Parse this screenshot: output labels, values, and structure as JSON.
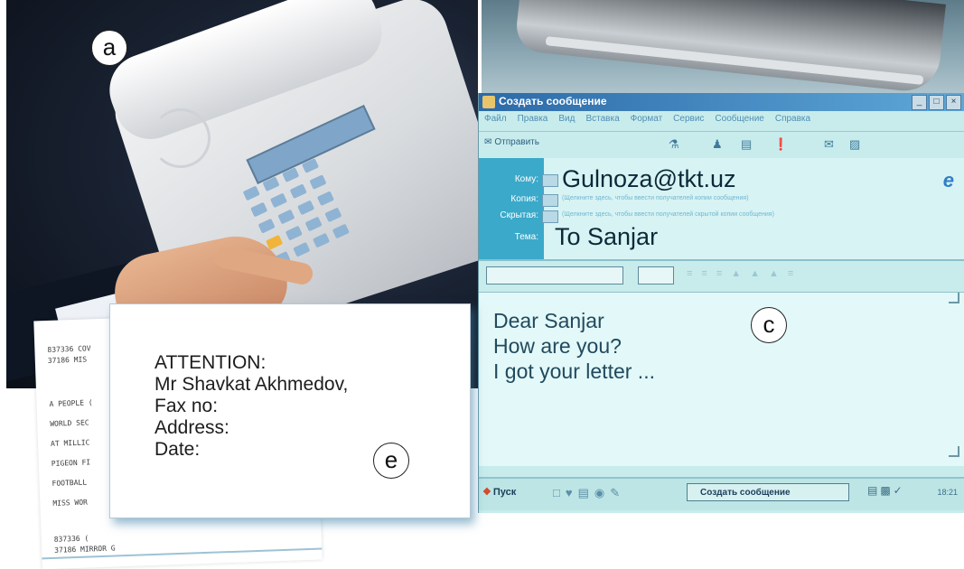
{
  "labels": {
    "a": "a",
    "c": "c",
    "e": "e"
  },
  "email_window": {
    "title": "Создать сообщение",
    "window_buttons": [
      "_",
      "□",
      "×"
    ],
    "menu": [
      "Файл",
      "Правка",
      "Вид",
      "Вставка",
      "Формат",
      "Сервис",
      "Сообщение",
      "Справка"
    ],
    "send_label": "Отправить",
    "headers": [
      {
        "label": "Кому:",
        "value": "Gulnoza@tkt.uz"
      },
      {
        "label": "Копия:",
        "value": "(Щелкните здесь, чтобы ввести получателей копии сообщения)"
      },
      {
        "label": "Скрытая:",
        "value": "(Щелкните здесь, чтобы ввести получателей скрытой копии сообщения)"
      },
      {
        "label": "Тема:",
        "value": "To Sanjar"
      }
    ],
    "body_lines": [
      "Dear Sanjar",
      "How are you?",
      "I got your letter ..."
    ],
    "taskbar": {
      "start_label": "Пуск",
      "task_label": "Создать сообщение",
      "clock": "18:21"
    }
  },
  "fax_printout": {
    "lines": [
      "837336 COV",
      "37186 MIS",
      "A PEOPLE (",
      "WORLD SEC",
      "AT MILLIC",
      "PIGEON FI",
      "FOOTBALL",
      "MISS WOR",
      "837336 (",
      "37186 MIRROR G"
    ]
  },
  "fax_cover": {
    "lines": [
      "ATTENTION:",
      "Mr Shavkat Akhmedov,",
      "Fax no:",
      "Address:",
      "Date:"
    ]
  },
  "colors": {
    "accent": "#3ba9c9",
    "card_shadow": "#3c82aa"
  }
}
